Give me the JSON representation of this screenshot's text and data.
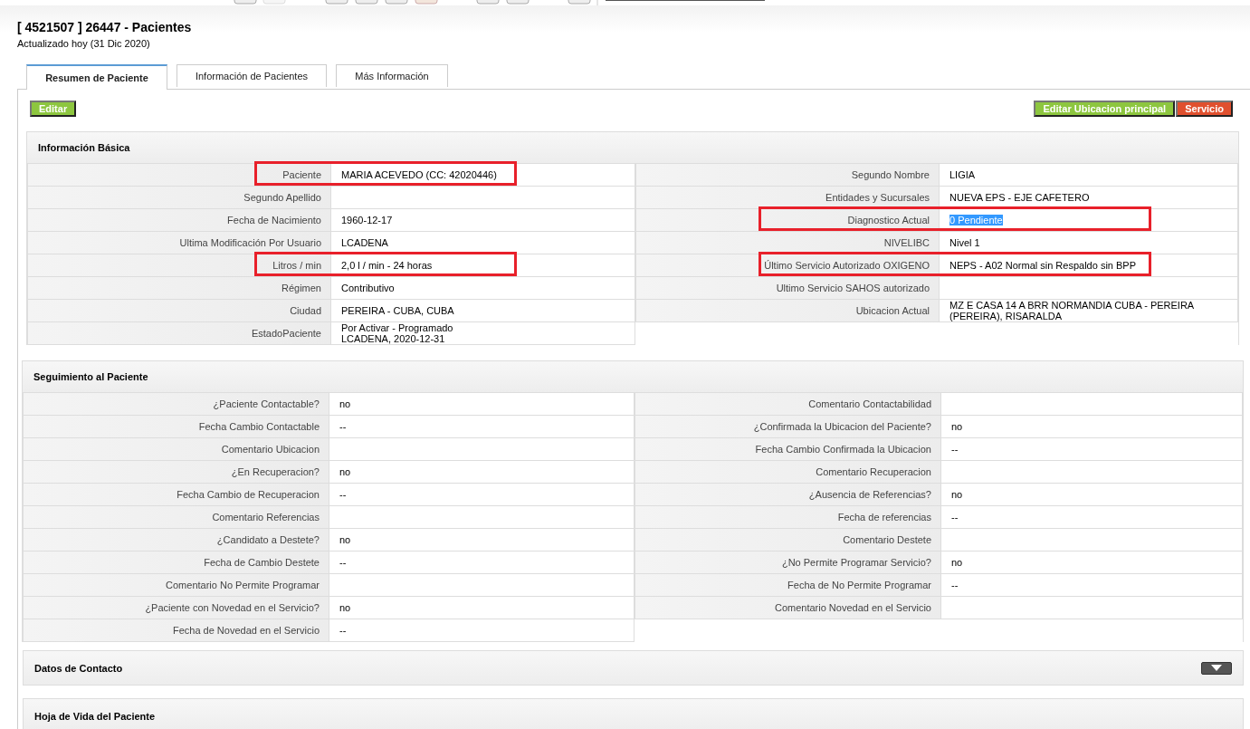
{
  "header": {
    "title": "[ 4521507 ] 26447 - Pacientes",
    "subtitle": "Actualizado hoy (31 Dic 2020)"
  },
  "tabs": [
    {
      "label": "Resumen de Paciente",
      "selected": true
    },
    {
      "label": "Información de Pacientes",
      "selected": false
    },
    {
      "label": "Más Información",
      "selected": false
    }
  ],
  "buttons_left": [
    {
      "label": "Editar",
      "color": "#8dc63f"
    }
  ],
  "buttons_right": [
    {
      "label": "Editar Ubicacion principal",
      "color": "#8dc63f"
    },
    {
      "label": "Servicio",
      "color": "#e0502e"
    }
  ],
  "basic_info": {
    "title": "Información Básica",
    "left": [
      {
        "label": "Paciente",
        "value": "MARIA ACEVEDO (CC: 42020446)",
        "highlighted": true,
        "text_selected": false
      },
      {
        "label": "Segundo Apellido",
        "highlighted": false
      },
      {
        "label": "Fecha de Nacimiento",
        "value": "1960-12-17",
        "highlighted": false,
        "text_selected": false
      },
      {
        "label": "Ultima Modificación Por Usuario",
        "value": "LCADENA",
        "highlighted": false,
        "text_selected": false
      },
      {
        "label": "Litros / min",
        "value": "2,0 l / min - 24 horas",
        "highlighted": true,
        "text_selected": false
      },
      {
        "label": "Régimen",
        "value": "Contributivo",
        "highlighted": false,
        "text_selected": false
      },
      {
        "label": "Ciudad",
        "value": "PEREIRA - CUBA, CUBA",
        "highlighted": false,
        "text_selected": false
      },
      {
        "label": "EstadoPaciente",
        "value": "Por Activar - Programado\nLCADENA, 2020-12-31",
        "highlighted": false,
        "text_selected": false
      }
    ],
    "right": [
      {
        "label": "Segundo Nombre",
        "value": "LIGIA",
        "highlighted": false,
        "text_selected": false
      },
      {
        "label": "Entidades y Sucursales",
        "value": "NUEVA EPS - EJE CAFETERO",
        "highlighted": false,
        "text_selected": false
      },
      {
        "label": "Diagnostico Actual",
        "value": "0 Pendiente",
        "highlighted": true,
        "text_selected": true
      },
      {
        "label": "NIVELIBC",
        "value": "Nivel 1",
        "highlighted": false,
        "text_selected": false
      },
      {
        "label": "Último Servicio Autorizado OXIGENO",
        "value": "NEPS - A02 Normal sin Respaldo sin BPP",
        "highlighted": true,
        "text_selected": false
      },
      {
        "label": "Ultimo Servicio SAHOS autorizado",
        "highlighted": false
      },
      {
        "label": "Ubicacion Actual",
        "value": "MZ E CASA 14 A BRR NORMANDIA CUBA - PEREIRA (PEREIRA), RISARALDA",
        "highlighted": false,
        "text_selected": false
      }
    ]
  },
  "follow_up": {
    "title": "Seguimiento al Paciente",
    "left": [
      {
        "label": "¿Paciente Contactable?",
        "value": "no"
      },
      {
        "label": "Fecha Cambio Contactable",
        "value": "--"
      },
      {
        "label": "Comentario Ubicacion"
      },
      {
        "label": "¿En Recuperacion?",
        "value": "no"
      },
      {
        "label": "Fecha Cambio de Recuperacion",
        "value": "--"
      },
      {
        "label": "Comentario Referencias"
      },
      {
        "label": "¿Candidato a Destete?",
        "value": "no"
      },
      {
        "label": "Fecha de Cambio Destete",
        "value": "--"
      },
      {
        "label": "Comentario No Permite Programar"
      },
      {
        "label": "¿Paciente con Novedad en el Servicio?",
        "value": "no"
      },
      {
        "label": "Fecha de Novedad en el Servicio",
        "value": "--"
      }
    ],
    "right": [
      {
        "label": "Comentario Contactabilidad"
      },
      {
        "label": "¿Confirmada la Ubicacion del Paciente?",
        "value": "no"
      },
      {
        "label": "Fecha Cambio Confirmada la Ubicacion",
        "value": "--"
      },
      {
        "label": "Comentario Recuperacion"
      },
      {
        "label": "¿Ausencia de Referencias?",
        "value": "no"
      },
      {
        "label": "Fecha de referencias",
        "value": "--"
      },
      {
        "label": "Comentario Destete"
      },
      {
        "label": "¿No Permite Programar Servicio?",
        "value": "no"
      },
      {
        "label": "Fecha de No Permite Programar",
        "value": "--"
      },
      {
        "label": "Comentario Novedad en el Servicio"
      }
    ]
  },
  "collapsed_sections": [
    {
      "title": "Datos de Contacto",
      "expanded": false
    },
    {
      "title": "Hoja de Vida del Paciente"
    }
  ]
}
